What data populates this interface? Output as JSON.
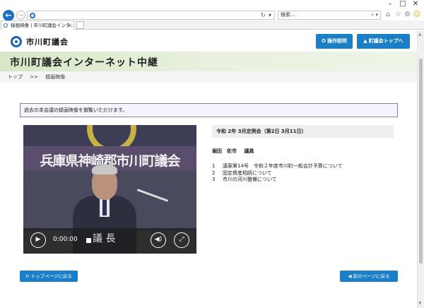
{
  "browser": {
    "search_placeholder": "検索...",
    "tab_title": "録画映像 | 市川町議会インタ..."
  },
  "header": {
    "logo_text": "市川町議会",
    "help_button": "操作説明",
    "top_button": "町議会トップへ"
  },
  "page": {
    "title": "市川町議会インターネット中継",
    "breadcrumb": [
      "トップ",
      ">>",
      "録画映像"
    ],
    "notice": "過去の本会議の録画映像を御覧いただけます。"
  },
  "video": {
    "caption": "兵庫県神崎郡市川町議会",
    "time": "0:00:00",
    "nameplate": "議 長"
  },
  "session": {
    "heading": "令和 2年 3月定例会（第2日 3月11日）",
    "speaker_name": "堀田　佐市",
    "speaker_role": "議員",
    "agenda": [
      {
        "num": "1",
        "text": "議案第14号　令和２年度市川町一般会計予算について"
      },
      {
        "num": "2",
        "text": "固定資産相続について"
      },
      {
        "num": "3",
        "text": "市川の河川整備について"
      }
    ]
  },
  "footer": {
    "back_top": "トップページに戻る",
    "back_prev": "前のページに戻る"
  }
}
